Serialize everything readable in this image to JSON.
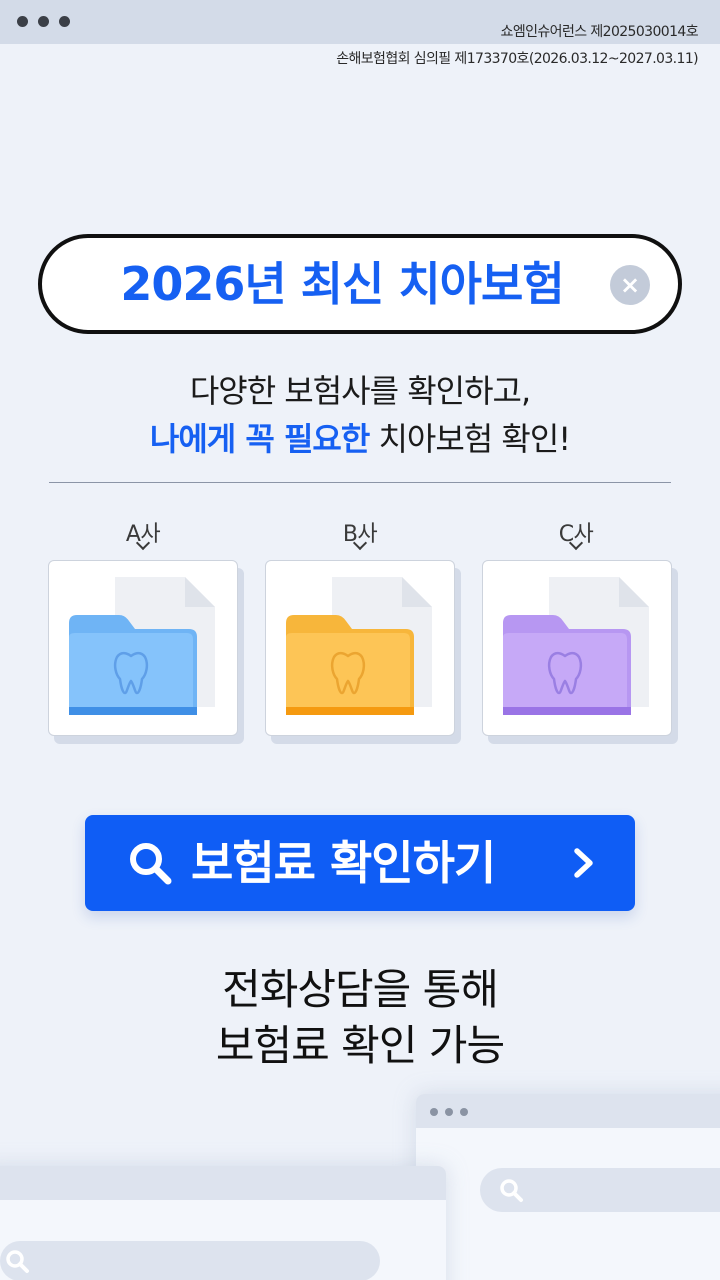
{
  "compliance": {
    "line1": "쇼엠인슈어런스 제2025030014호",
    "line2": "손해보험협회 심의필 제173370호(2026.03.12~2027.03.11)"
  },
  "search": {
    "query": "2026년 최신 치아보험",
    "clear_icon": "close-icon",
    "clear_symbol": "×"
  },
  "subtitle": {
    "line1": "다양한 보험사를 확인하고,",
    "line2_highlight": "나에게 꼭 필요한",
    "line2_rest": " 치아보험 확인!"
  },
  "cards": [
    {
      "label": "A사",
      "folder_color": "#6fb4f5",
      "folder_front": "#85c3fb",
      "folder_edge": "#3f8fe6",
      "tooth_color": "#5f9fe8"
    },
    {
      "label": "B사",
      "folder_color": "#f7b63b",
      "folder_front": "#fdc556",
      "folder_edge": "#f59a10",
      "tooth_color": "#eba531"
    },
    {
      "label": "C사",
      "folder_color": "#b797f2",
      "folder_front": "#c6a9f7",
      "folder_edge": "#9a74e6",
      "tooth_color": "#9a7fe3"
    }
  ],
  "cta": {
    "label": "보험료 확인하기",
    "icon": "search-icon",
    "arrow_icon": "chevron-right-icon",
    "color": "#0f5df5"
  },
  "info": {
    "line1": "전화상담을 통해",
    "line2": "보험료 확인 가능"
  },
  "colors": {
    "accent": "#1660f2",
    "background": "#eef2f9"
  }
}
